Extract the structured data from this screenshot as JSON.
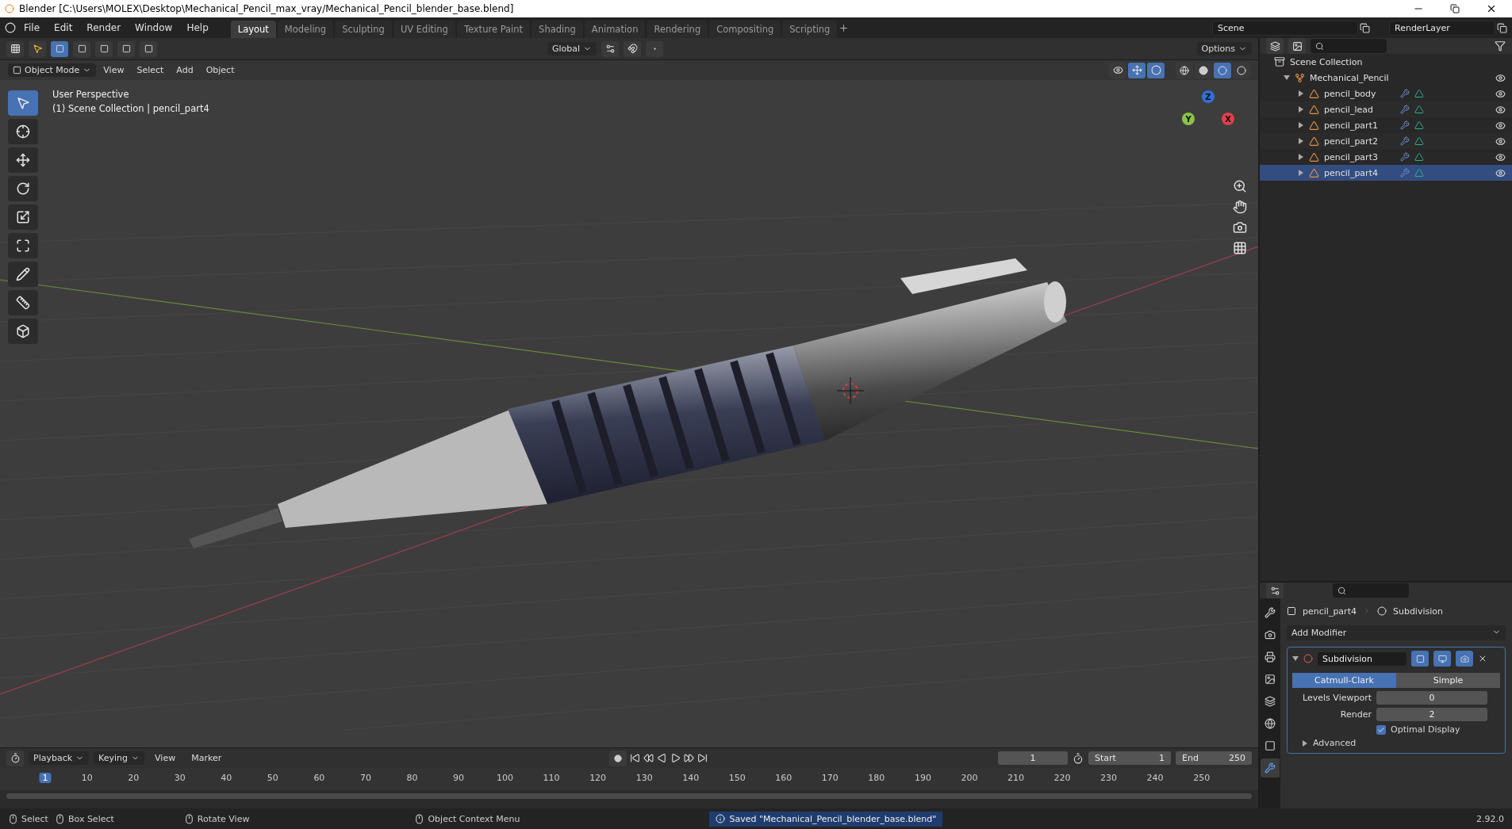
{
  "window": {
    "title": "Blender [C:\\Users\\MOLEX\\Desktop\\Mechanical_Pencil_max_vray/Mechanical_Pencil_blender_base.blend]"
  },
  "menu": [
    "File",
    "Edit",
    "Render",
    "Window",
    "Help"
  ],
  "workspaces": [
    {
      "label": "Layout",
      "selected": true
    },
    {
      "label": "Modeling",
      "selected": false
    },
    {
      "label": "Sculpting",
      "selected": false
    },
    {
      "label": "UV Editing",
      "selected": false
    },
    {
      "label": "Texture Paint",
      "selected": false
    },
    {
      "label": "Shading",
      "selected": false
    },
    {
      "label": "Animation",
      "selected": false
    },
    {
      "label": "Rendering",
      "selected": false
    },
    {
      "label": "Compositing",
      "selected": false
    },
    {
      "label": "Scripting",
      "selected": false
    }
  ],
  "scene": {
    "name": "Scene"
  },
  "view_layer": {
    "name": "RenderLayer"
  },
  "tool_header": {
    "orientation": "Global",
    "options": "Options"
  },
  "viewport_header": {
    "mode": "Object Mode",
    "menus": [
      "View",
      "Select",
      "Add",
      "Object"
    ]
  },
  "shading_modes": [
    {
      "kind": "wireframe",
      "selected": false
    },
    {
      "kind": "solid",
      "selected": false
    },
    {
      "kind": "material",
      "selected": true
    },
    {
      "kind": "rendered",
      "selected": false
    }
  ],
  "viewport": {
    "overlay_lines": [
      "User Perspective",
      "(1) Scene Collection | pencil_part4"
    ],
    "gizmo_axes": [
      {
        "label": "Z",
        "color": "#2f6fd6"
      },
      {
        "label": "Y",
        "color": "#8bc34a"
      },
      {
        "label": "X",
        "color": "#e0404a"
      }
    ]
  },
  "toolbar": [
    {
      "kind": "select",
      "selected": true
    },
    {
      "kind": "cursor",
      "selected": false
    },
    {
      "kind": "move",
      "selected": false
    },
    {
      "kind": "rotate",
      "selected": false
    },
    {
      "kind": "scale",
      "selected": false
    },
    {
      "kind": "transform",
      "selected": false
    },
    {
      "kind": "annotate",
      "selected": false
    },
    {
      "kind": "measure",
      "selected": false
    },
    {
      "kind": "add_cube",
      "selected": false
    }
  ],
  "outliner": {
    "root": "Scene Collection",
    "tree": [
      {
        "name": "Mechanical_Pencil",
        "kind": "empty",
        "expanded": true,
        "active": false,
        "children": [
          {
            "name": "pencil_body",
            "kind": "mesh",
            "expanded": false,
            "active": false
          },
          {
            "name": "pencil_lead",
            "kind": "mesh",
            "expanded": false,
            "active": false
          },
          {
            "name": "pencil_part1",
            "kind": "mesh",
            "expanded": false,
            "active": false
          },
          {
            "name": "pencil_part2",
            "kind": "mesh",
            "expanded": false,
            "active": false
          },
          {
            "name": "pencil_part3",
            "kind": "mesh",
            "expanded": false,
            "active": false
          },
          {
            "name": "pencil_part4",
            "kind": "mesh",
            "expanded": false,
            "active": true
          }
        ]
      }
    ]
  },
  "properties": {
    "tabs": [
      {
        "kind": "tool",
        "selected": false
      },
      {
        "kind": "render",
        "selected": false
      },
      {
        "kind": "output",
        "selected": false
      },
      {
        "kind": "view_layer",
        "selected": false
      },
      {
        "kind": "scene",
        "selected": false
      },
      {
        "kind": "world",
        "selected": false
      },
      {
        "kind": "object",
        "selected": false
      },
      {
        "kind": "modifier",
        "selected": true
      }
    ],
    "breadcrumb": [
      "pencil_part4",
      "Subdivision"
    ],
    "add_modifier": "Add Modifier",
    "modifier": {
      "name": "Subdivision",
      "expanded": true,
      "types": [
        {
          "label": "Catmull-Clark",
          "selected": true
        },
        {
          "label": "Simple",
          "selected": false
        }
      ],
      "fields": [
        {
          "label": "Levels Viewport",
          "value": "0"
        },
        {
          "label": "Render",
          "value": "2"
        }
      ],
      "optimal_display": {
        "label": "Optimal Display",
        "checked": true
      },
      "advanced": {
        "label": "Advanced",
        "expanded": false
      }
    }
  },
  "timeline": {
    "menus": [
      "Playback",
      "Keying",
      "View",
      "Marker"
    ],
    "current_frame": "1",
    "start_label": "Start",
    "start": "1",
    "end_label": "End",
    "end": "250",
    "ticks": [
      "1",
      "10",
      "20",
      "30",
      "40",
      "50",
      "60",
      "70",
      "80",
      "90",
      "100",
      "110",
      "120",
      "130",
      "140",
      "150",
      "160",
      "170",
      "180",
      "190",
      "200",
      "210",
      "220",
      "230",
      "240",
      "250"
    ]
  },
  "status_bar": {
    "hints": [
      "Select",
      "Box Select",
      "Rotate View",
      "Object Context Menu"
    ],
    "message": "Saved \"Mechanical_Pencil_blender_base.blend\"",
    "version": "2.92.0"
  }
}
